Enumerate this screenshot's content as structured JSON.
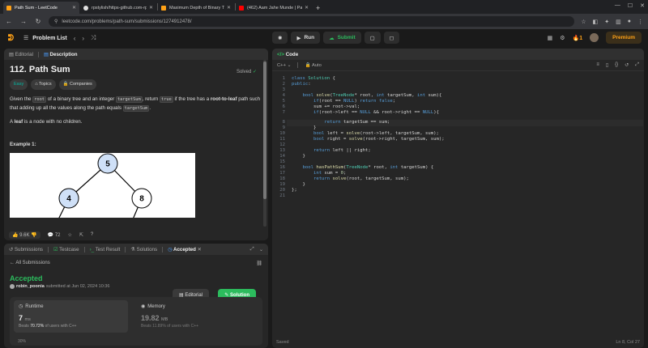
{
  "browser": {
    "tabs": [
      {
        "title": "Path Sum - LeetCode",
        "active": true,
        "color": "#ffa116"
      },
      {
        "title": "rpstylish/https-github.com-rpst",
        "active": false,
        "color": "#e0e0e0"
      },
      {
        "title": "Maximum Depth of Binary Tree",
        "active": false,
        "color": "#ffa116"
      },
      {
        "title": "(462) Aam Jahe Munde | Parmi",
        "active": false,
        "color": "#ff0000"
      }
    ],
    "url": "leetcode.com/problems/path-sum/submissions/1274912478/"
  },
  "topbar": {
    "problem_list": "Problem List",
    "run": "Run",
    "submit": "Submit",
    "streak": "1",
    "premium": "Premium"
  },
  "description": {
    "tab_editorial": "Editorial",
    "tab_description": "Description",
    "title": "112. Path Sum",
    "solved": "Solved",
    "tag_easy": "Easy",
    "tag_topics": "Topics",
    "tag_companies": "Companies",
    "p1_a": "Given the ",
    "p1_code_root": "root",
    "p1_b": " of a binary tree and an integer ",
    "p1_code_target": "targetSum",
    "p1_c": ", return ",
    "p1_code_true": "true",
    "p1_d": " if the tree has a ",
    "p1_bold": "root-to-leaf",
    "p1_e": " path such that adding up all the values along the path equals ",
    "p1_code_target2": "targetSum",
    "p1_f": ".",
    "p2_a": "A ",
    "p2_bold": "leaf",
    "p2_b": " is a node with no children.",
    "example_heading": "Example 1:",
    "tree_nodes": [
      "5",
      "4",
      "8"
    ],
    "likes": "9.6K",
    "comments": "72"
  },
  "submission": {
    "tab_submissions": "Submissions",
    "tab_testcase": "Testcase",
    "tab_testresult": "Test Result",
    "tab_solutions": "Solutions",
    "tab_accepted": "Accepted",
    "all_submissions": "All Submissions",
    "status": "Accepted",
    "user": "robin_poonia",
    "submitted_at": "submitted at Jun 02, 2024 10:36",
    "editorial_btn": "Editorial",
    "solution_btn": "Solution",
    "runtime_label": "Runtime",
    "runtime_value": "7",
    "runtime_unit": "ms",
    "runtime_beats_pre": "Beats ",
    "runtime_beats_pct": "70.72%",
    "runtime_beats_post": " of users with C++",
    "memory_label": "Memory",
    "memory_value": "19.82",
    "memory_unit": "MB",
    "memory_beats": "Beats 11.89% of users with C++",
    "pct_tick": "30%"
  },
  "code": {
    "tab": "Code",
    "language": "C++",
    "autosave": "Auto",
    "status_saved": "Saved",
    "cursor": "Ln 8, Col 27"
  }
}
